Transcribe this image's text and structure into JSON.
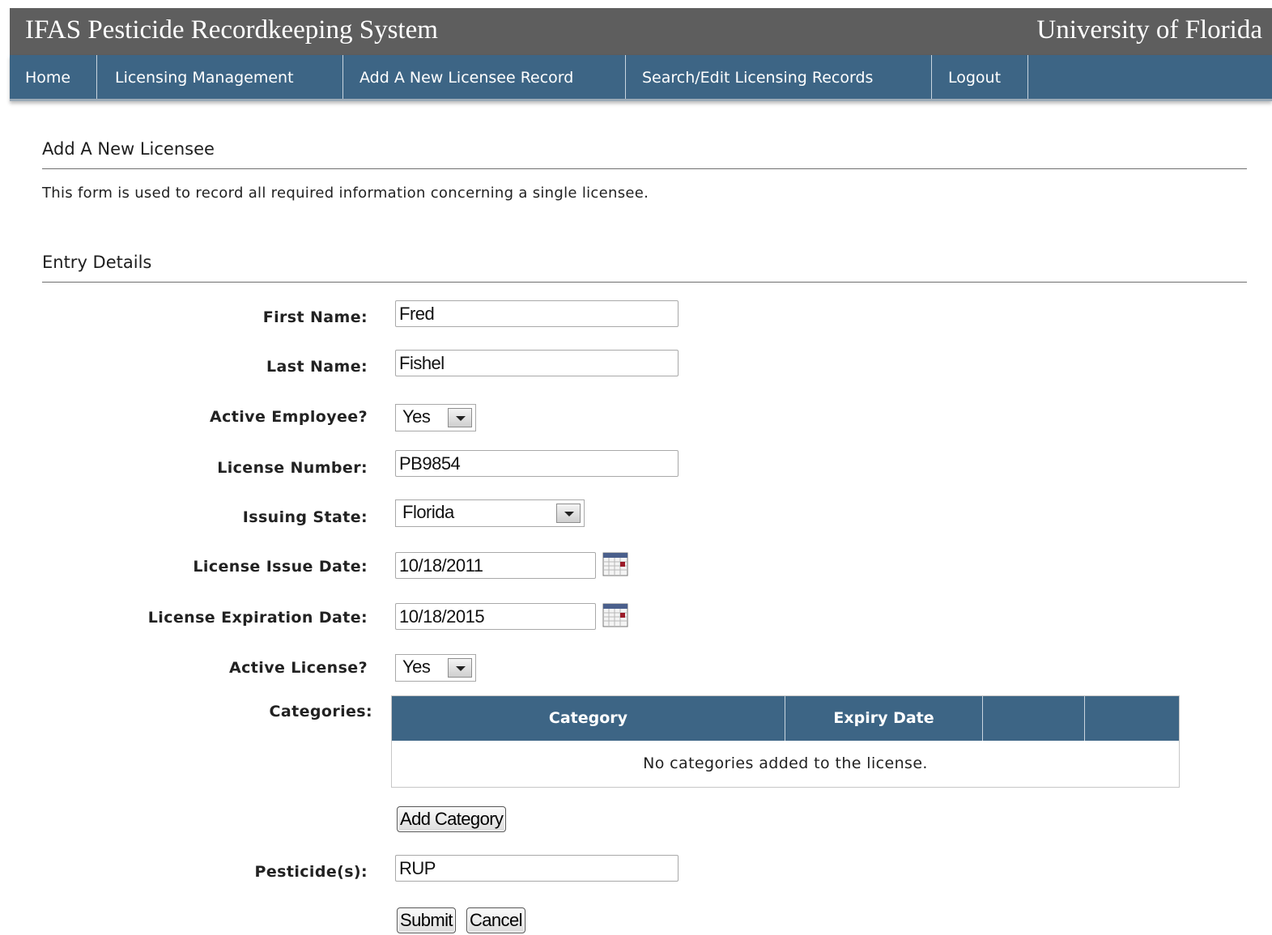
{
  "header": {
    "app_title": "IFAS Pesticide Recordkeeping System",
    "org_title": "University of Florida"
  },
  "nav": {
    "items": [
      {
        "label": "Home"
      },
      {
        "label": "Licensing Management"
      },
      {
        "label": "Add A New Licensee Record"
      },
      {
        "label": "Search/Edit Licensing Records"
      },
      {
        "label": "Logout"
      }
    ]
  },
  "page": {
    "title": "Add A New Licensee",
    "intro": "This form is used to record all required information concerning a single licensee.",
    "section_title": "Entry Details"
  },
  "form": {
    "first_name": {
      "label": "First Name:",
      "value": "Fred"
    },
    "last_name": {
      "label": "Last Name:",
      "value": "Fishel"
    },
    "active_employee": {
      "label": "Active Employee?",
      "value": "Yes"
    },
    "license_number": {
      "label": "License Number:",
      "value": "PB9854"
    },
    "issuing_state": {
      "label": "Issuing State:",
      "value": "Florida"
    },
    "issue_date": {
      "label": "License Issue Date:",
      "value": "10/18/2011"
    },
    "expiration_date": {
      "label": "License Expiration Date:",
      "value": "10/18/2015"
    },
    "active_license": {
      "label": "Active License?",
      "value": "Yes"
    },
    "categories": {
      "label": "Categories:",
      "columns": [
        "Category",
        "Expiry Date",
        "",
        ""
      ],
      "empty_message": "No categories added to the license.",
      "add_button": "Add Category"
    },
    "pesticides": {
      "label": "Pesticide(s):",
      "value": "RUP"
    },
    "submit_label": "Submit",
    "cancel_label": "Cancel"
  },
  "icons": {
    "calendar": "calendar-icon",
    "dropdown": "chevron-down-icon"
  },
  "colors": {
    "title_bar": "#5e5e5e",
    "nav_bar": "#3d6585",
    "table_header": "#3d6585"
  }
}
